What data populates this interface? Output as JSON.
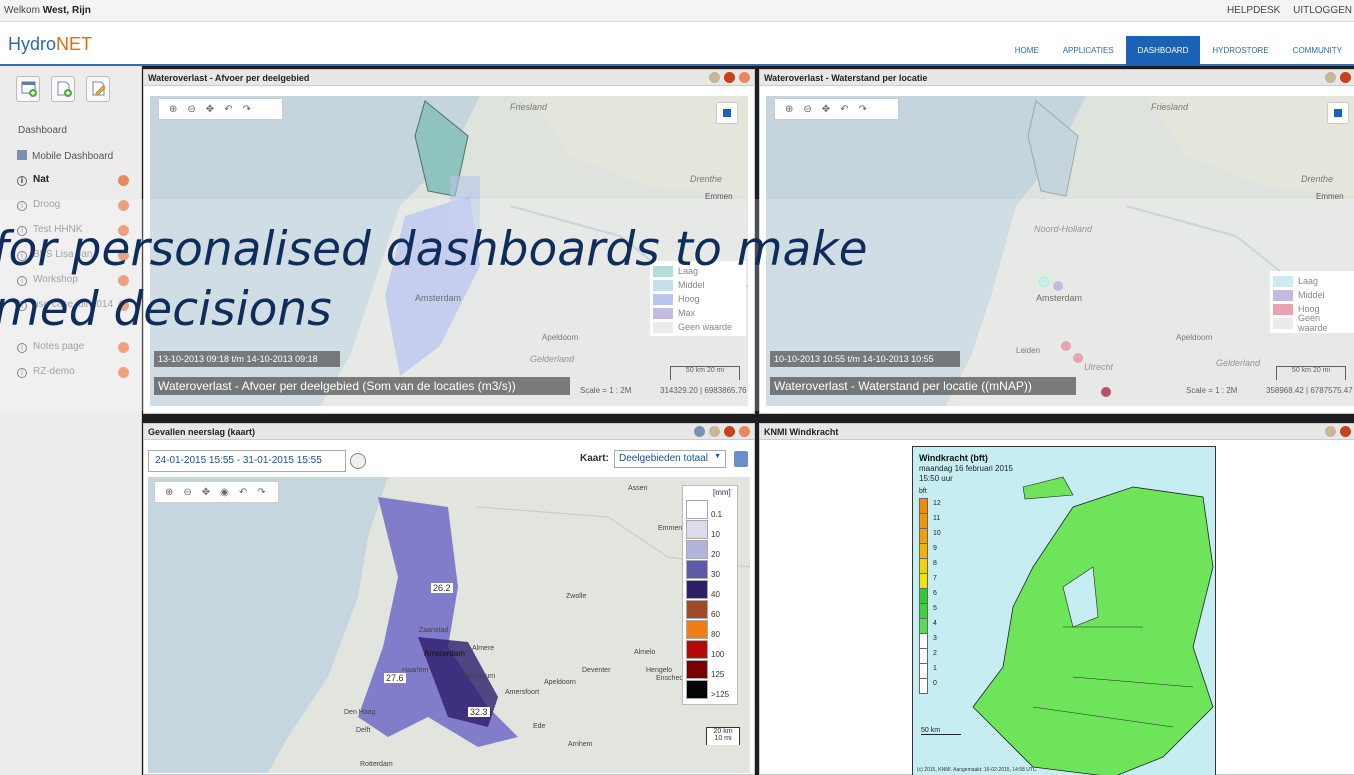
{
  "topbar": {
    "welcome_prefix": "Welkom",
    "welcome_user": "West, Rijn",
    "helpdesk": "HELPDESK",
    "logout": "UITLOGGEN"
  },
  "logo": {
    "hydro": "Hydro",
    "net": "NET"
  },
  "nav": [
    {
      "label": "HOME"
    },
    {
      "label": "APPLICATIES"
    },
    {
      "label": "DASHBOARD",
      "active": true
    },
    {
      "label": "HYDROSTORE"
    },
    {
      "label": "COMMUNITY"
    }
  ],
  "sidebar": {
    "dashboard_label": "Dashboard",
    "mobile_dashboard": "Mobile Dashboard",
    "items": [
      {
        "label": "Nat",
        "active": true
      },
      {
        "label": "Droog"
      },
      {
        "label": "Test HHNK"
      },
      {
        "label": "BFS Lisa Jan"
      },
      {
        "label": "Workshop"
      },
      {
        "label": "use case juli 2014"
      },
      {
        "label": "Notes page"
      },
      {
        "label": "RZ-demo"
      }
    ]
  },
  "panels": {
    "p1": {
      "title": "Wateroverlast - Afvoer per deelgebied",
      "time": "13-10-2013 09:18 t/m 14-10-2013 09:18",
      "caption": "Wateroverlast - Afvoer per deelgebied (Som van de locaties (m3/s))",
      "scale": "Scale = 1 : 2M",
      "coords": "314329.20 | 6983865.76",
      "legend": [
        {
          "label": "Laag",
          "color": "#9fd3cf"
        },
        {
          "label": "Middel",
          "color": "#b4d8e6"
        },
        {
          "label": "Hoog",
          "color": "#a9b4ef"
        },
        {
          "label": "Max",
          "color": "#b4a8dc"
        },
        {
          "label": "Geen waarde",
          "color": "#e6e6e6"
        }
      ],
      "places": {
        "friesland": "Friesland",
        "drenthe": "Drenthe",
        "emmen": "Emmen",
        "amsterdam": "Amsterdam",
        "apeldoorn": "Apeldoorn",
        "gelderland": "Gelderland"
      },
      "scalebar_km": "50 km",
      "scalebar_mi": "20 mi"
    },
    "p2": {
      "title": "Wateroverlast - Waterstand per locatie",
      "time": "10-10-2013 10:55 t/m 14-10-2013 10:55",
      "caption": "Wateroverlast - Waterstand per locatie ((mNAP))",
      "scale": "Scale = 1 : 2M",
      "coords": "358968.42 | 6787575.47",
      "legend": [
        {
          "label": "Laag",
          "color": "#bfe3ee"
        },
        {
          "label": "Middel",
          "color": "#b3a6d9"
        },
        {
          "label": "Hoog",
          "color": "#e08a9b"
        },
        {
          "label": "Geen waarde",
          "color": "#e6e6e6"
        }
      ],
      "places": {
        "friesland": "Friesland",
        "drenthe": "Drenthe",
        "emmen": "Emmen",
        "noord_holland": "Noord-Holland",
        "amsterdam": "Amsterdam",
        "leiden": "Leiden",
        "utrecht": "Utrecht",
        "apeldoorn": "Apeldoorn",
        "gelderland": "Gelderland"
      },
      "scalebar_km": "50 km",
      "scalebar_mi": "20 mi"
    },
    "p3": {
      "title": "Gevallen neerslag (kaart)",
      "date_range": "24-01-2015 15:55 - 31-01-2015 15:55",
      "kaart_label": "Kaart:",
      "kaart_value": "Deelgebieden totaal",
      "unit": "[mm]",
      "scale": [
        {
          "label": "0.1",
          "color": "#ffffff"
        },
        {
          "label": "10",
          "color": "#dadbec"
        },
        {
          "label": "20",
          "color": "#b3b4dc"
        },
        {
          "label": "30",
          "color": "#5e5aa8"
        },
        {
          "label": "40",
          "color": "#2e1d6b"
        },
        {
          "label": "60",
          "color": "#a04a2a"
        },
        {
          "label": "80",
          "color": "#f07d14"
        },
        {
          "label": "100",
          "color": "#b60a0a"
        },
        {
          "label": "125",
          "color": "#7a0000"
        },
        {
          "label": ">125",
          "color": "#050505"
        }
      ],
      "values": {
        "a": "26.2",
        "b": "27.6",
        "c": "32.3"
      },
      "places": {
        "assen": "Assen",
        "emmen": "Emmen",
        "zwolle": "Zwolle",
        "amsterdam": "Amsterdam",
        "almere": "Almere",
        "hilversum": "Hilversum",
        "amersfoort": "Amersfoort",
        "apeldoorn": "Apeldoorn",
        "deventer": "Deventer",
        "almelo": "Almelo",
        "hengelo": "Hengelo",
        "enschede": "Enschede",
        "den_haag": "Den Haag",
        "delft": "Delft",
        "rotterdam": "Rotterdam",
        "ede": "Ede",
        "arnhem": "Arnhem",
        "zaanstad": "Zaanstad",
        "haarlem": "Haarlem"
      },
      "scalebar_km": "20 km",
      "scalebar_mi": "10 mi"
    },
    "p4": {
      "title": "KNMI Windkracht",
      "map_title": "Windkracht (bft)",
      "date": "maandag 16 februari 2015",
      "time": "15:50 uur",
      "unit": "bft",
      "scale": [
        {
          "label": "12",
          "color": "#f08c00"
        },
        {
          "label": "11",
          "color": "#f09600"
        },
        {
          "label": "10",
          "color": "#f0a000"
        },
        {
          "label": "9",
          "color": "#f0b400"
        },
        {
          "label": "8",
          "color": "#f0d200"
        },
        {
          "label": "7",
          "color": "#eee600"
        },
        {
          "label": "6",
          "color": "#34c834"
        },
        {
          "label": "5",
          "color": "#3cd23c"
        },
        {
          "label": "4",
          "color": "#50e050"
        },
        {
          "label": "3",
          "color": "#ffffff"
        },
        {
          "label": "2",
          "color": "#ffffff"
        },
        {
          "label": "1",
          "color": "#ffffff"
        },
        {
          "label": "0",
          "color": "#ffffff"
        }
      ],
      "scalebar": "50 km",
      "copyright": "(c) 2015, KNMI. Aangemaakt: 16-02-2015, 14:58 UTC"
    }
  },
  "overlay": {
    "line1": "for personalised dashboards to make",
    "line2": "med decisions"
  }
}
